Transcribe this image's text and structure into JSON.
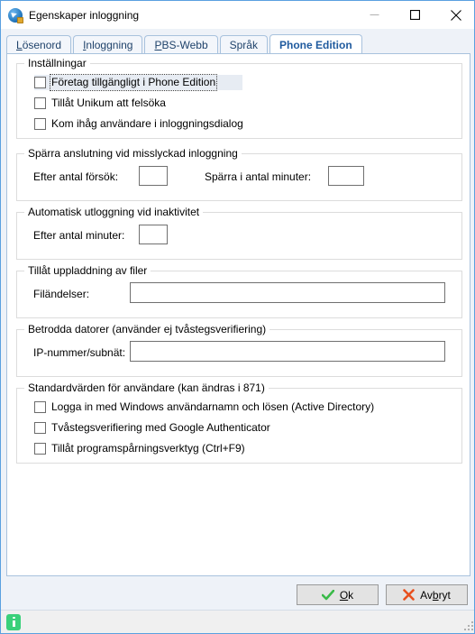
{
  "window": {
    "title": "Egenskaper inloggning",
    "icon": "app-globe-icon",
    "controls": {
      "minimize": "—",
      "maximize": "☐",
      "close": "✕"
    },
    "accent_color": "#5aa0e0",
    "titlebar_bg": "#ffffff",
    "dialog_bg": "#eef2f8"
  },
  "tabs": [
    {
      "label": "Lösenord",
      "accel": "L",
      "rest": "ösenord",
      "active": false
    },
    {
      "label": "Inloggning",
      "accel": "I",
      "rest": "nloggning",
      "active": false
    },
    {
      "label": "PBS-Webb",
      "accel": "P",
      "rest": "BS-Webb",
      "active": false
    },
    {
      "label": "Språk",
      "accel": "",
      "rest": "Språk",
      "active": false
    },
    {
      "label": "Phone Edition",
      "accel": "",
      "rest": "Phone Edition",
      "active": true
    }
  ],
  "groups": {
    "installningar": {
      "legend": "Inställningar",
      "checkboxes": [
        {
          "label": "Företag tillgängligt i Phone Edition",
          "checked": false,
          "focused": true
        },
        {
          "label": "Tillåt Unikum att felsöka",
          "checked": false,
          "focused": false
        },
        {
          "label": "Kom ihåg användare i inloggningsdialog",
          "checked": false,
          "focused": false
        }
      ]
    },
    "sparra_anslutning": {
      "legend": "Spärra anslutning vid misslyckad inloggning",
      "fields": [
        {
          "label": "Efter antal försök:",
          "value": ""
        },
        {
          "label": "Spärra i antal minuter:",
          "value": ""
        }
      ]
    },
    "automatisk_utloggning": {
      "legend": "Automatisk utloggning vid inaktivitet",
      "fields": [
        {
          "label": "Efter antal minuter:",
          "value": ""
        }
      ]
    },
    "uppladdning": {
      "legend": "Tillåt uppladdning av filer",
      "fields": [
        {
          "label": "Filändelser:",
          "value": ""
        }
      ]
    },
    "betrodda_datorer": {
      "legend": "Betrodda datorer (använder ej tvåstegsverifiering)",
      "fields": [
        {
          "label": "IP-nummer/subnät:",
          "value": ""
        }
      ]
    },
    "standardvarden": {
      "legend": "Standardvärden för användare (kan ändras i 871)",
      "checkboxes": [
        {
          "label": "Logga in med Windows användarnamn och lösen (Active Directory)",
          "checked": false,
          "focused": false
        },
        {
          "label": "Tvåstegsverifiering med Google Authenticator",
          "checked": false,
          "focused": false
        },
        {
          "label": "Tillåt programspårningsverktyg (Ctrl+F9)",
          "checked": false,
          "focused": false
        }
      ]
    }
  },
  "buttons": {
    "ok": {
      "accel": "O",
      "rest": "k",
      "icon": "check-icon",
      "icon_color": "#3aba49"
    },
    "cancel": {
      "pre": "Av",
      "accel": "b",
      "rest": "ryt",
      "icon": "cross-icon",
      "icon_color": "#e8501e"
    }
  },
  "statusbar": {
    "icon": "info-icon",
    "icon_color": "#3ad07a",
    "text": ""
  }
}
